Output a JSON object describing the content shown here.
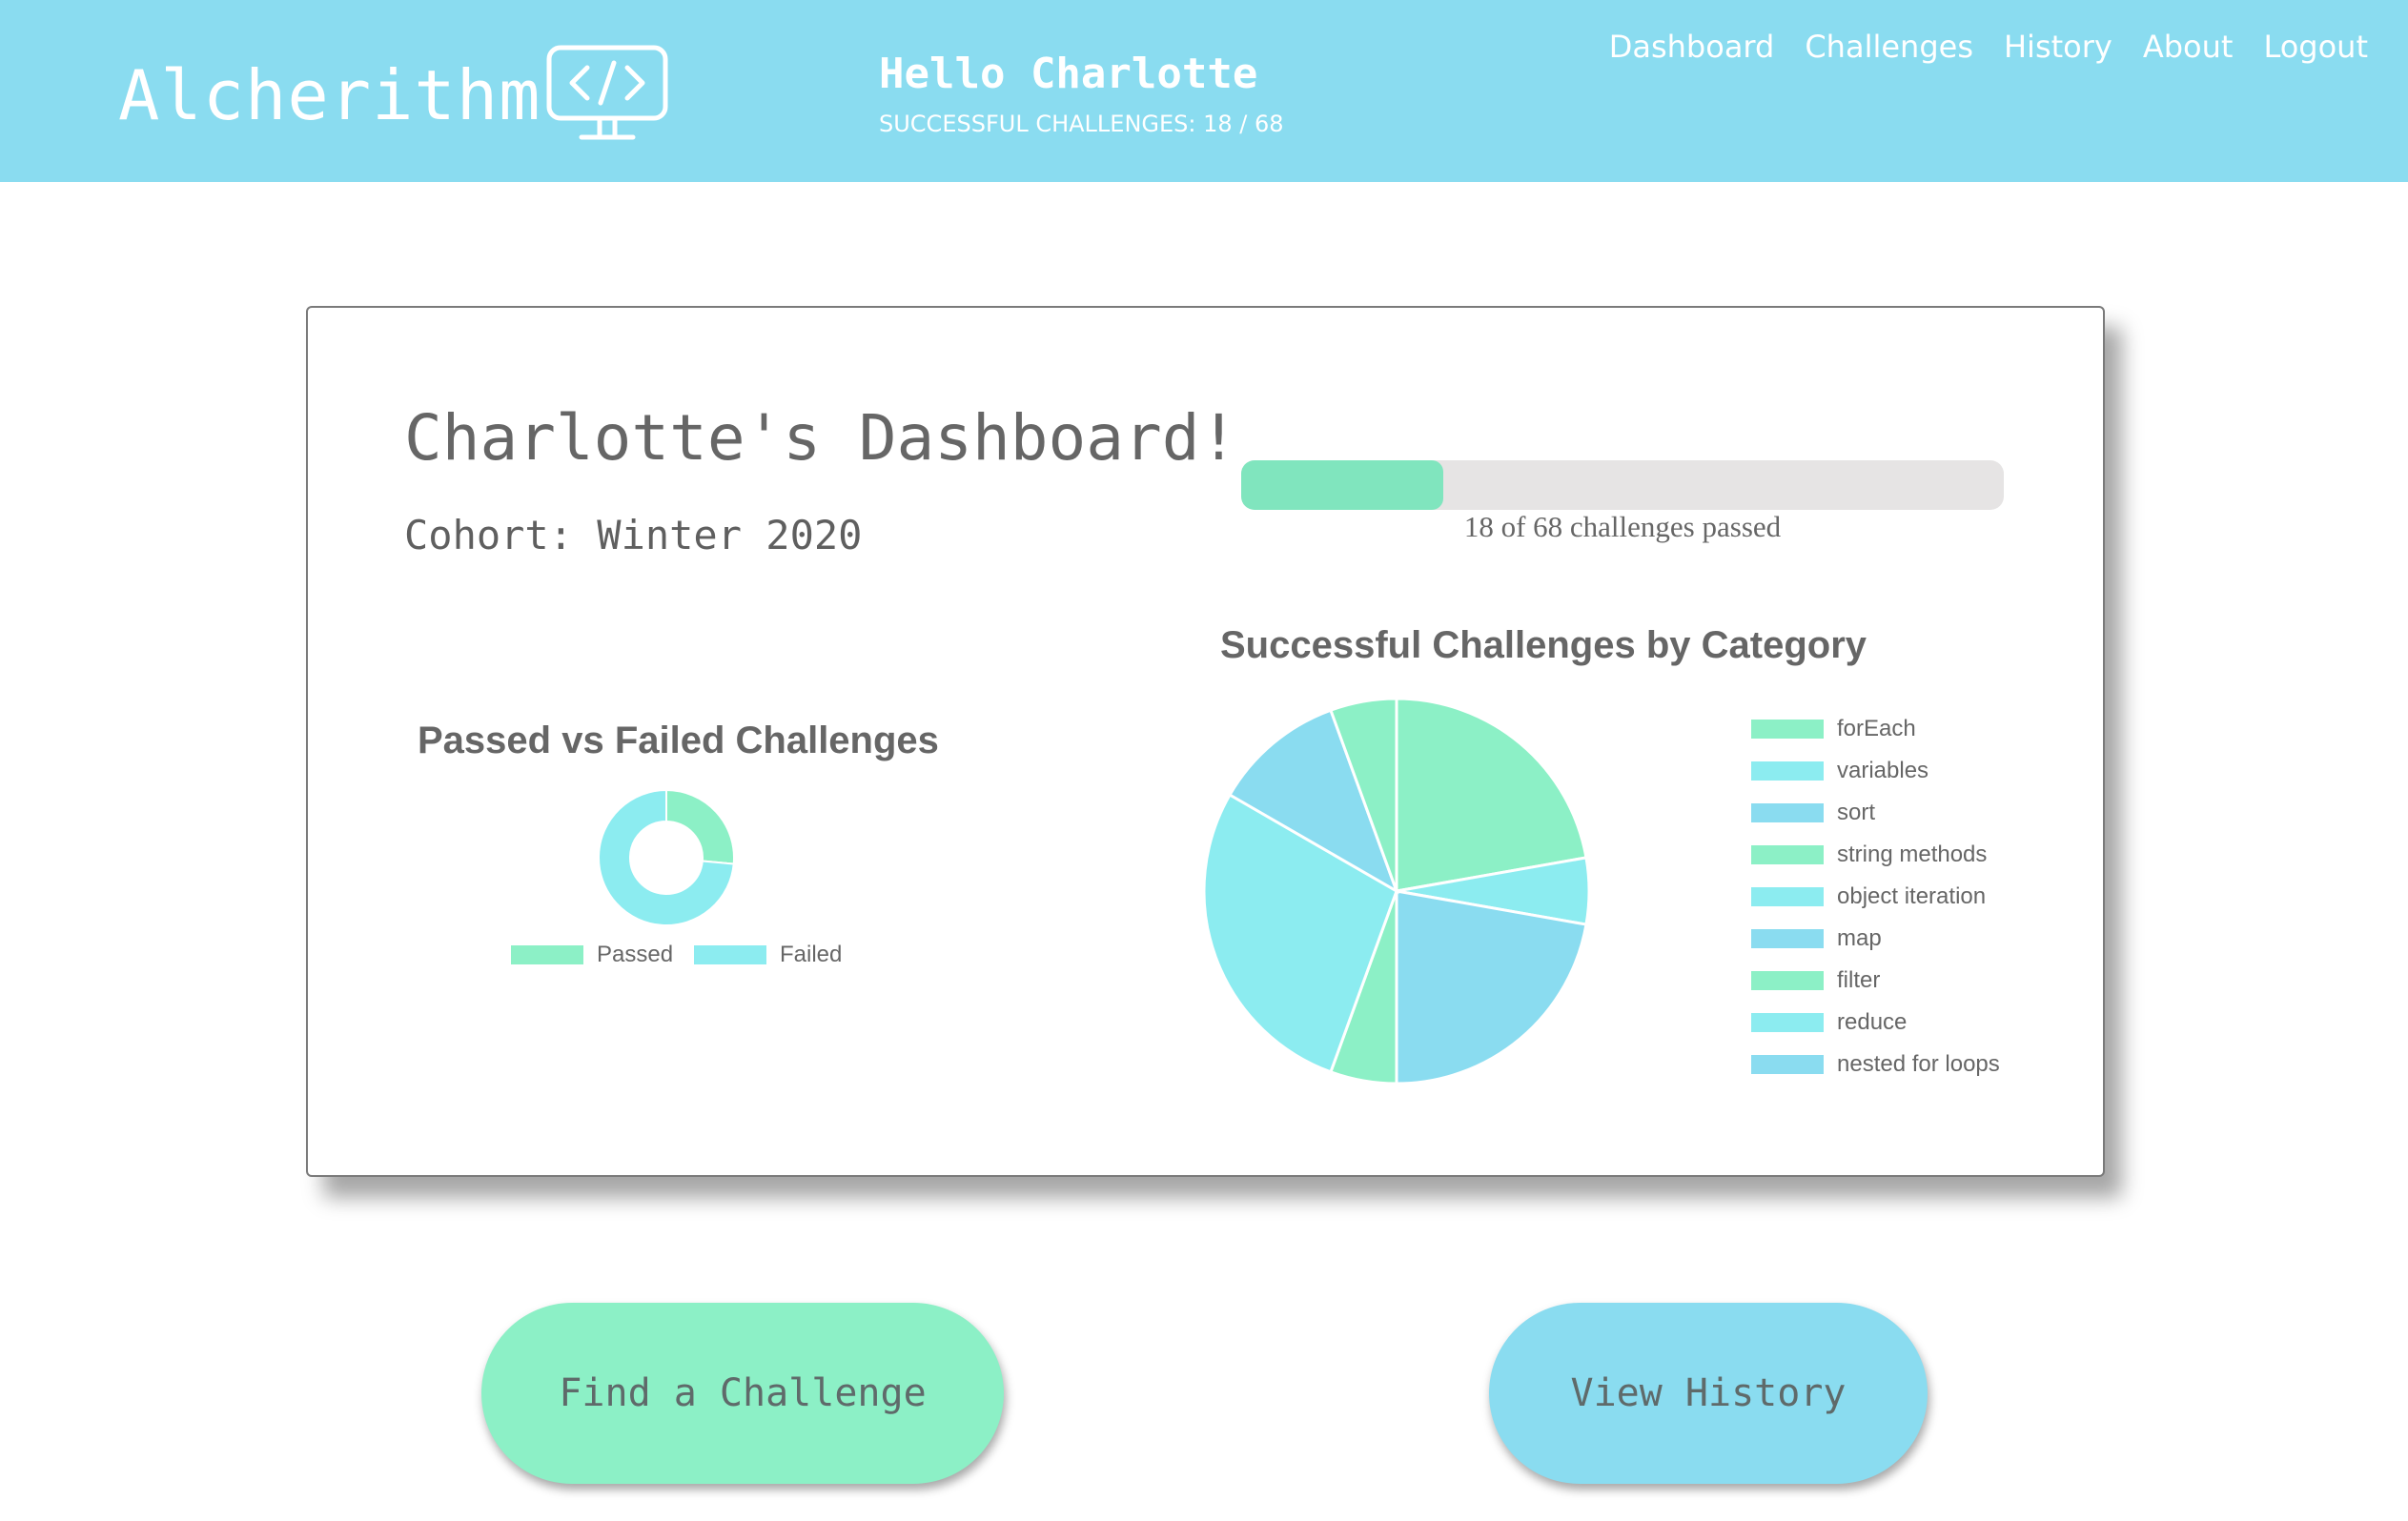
{
  "header": {
    "brand": "Alcherithm",
    "greeting": "Hello Charlotte",
    "sub_greeting": "SUCCESSFUL CHALLENGES: 18 / 68",
    "nav": [
      "Dashboard",
      "Challenges",
      "History",
      "About",
      "Logout"
    ]
  },
  "dashboard": {
    "title": "Charlotte's Dashboard!",
    "cohort": "Cohort: Winter 2020",
    "progress": {
      "passed": 18,
      "total": 68,
      "label": "18 of 68 challenges passed"
    }
  },
  "colors": {
    "header_bg": "#8adcf0",
    "mint": "#8cf0c6",
    "aqua": "#8cecf0",
    "sky": "#8adcf0",
    "progress_fill": "#80e5be",
    "progress_track": "#e6e4e4"
  },
  "chart_data": [
    {
      "type": "doughnut",
      "title": "Passed vs Failed Challenges",
      "categories": [
        "Passed",
        "Failed"
      ],
      "values": [
        18,
        50
      ],
      "colors": [
        "#8cf0c6",
        "#8cecf0"
      ]
    },
    {
      "type": "pie",
      "title": "Successful Challenges by Category",
      "categories": [
        "forEach",
        "variables",
        "sort",
        "string methods",
        "object iteration",
        "map",
        "filter",
        "reduce",
        "nested for loops"
      ],
      "values": [
        4,
        1,
        4,
        1,
        5,
        2,
        1,
        0,
        0
      ],
      "colors": [
        "#8cf0c6",
        "#8cecf0",
        "#8adcf0",
        "#8cf0c6",
        "#8cecf0",
        "#8adcf0",
        "#8cf0c6",
        "#8cecf0",
        "#8adcf0"
      ],
      "legend_position": "right"
    }
  ],
  "actions": {
    "find_challenge": "Find a Challenge",
    "view_history": "View History"
  }
}
